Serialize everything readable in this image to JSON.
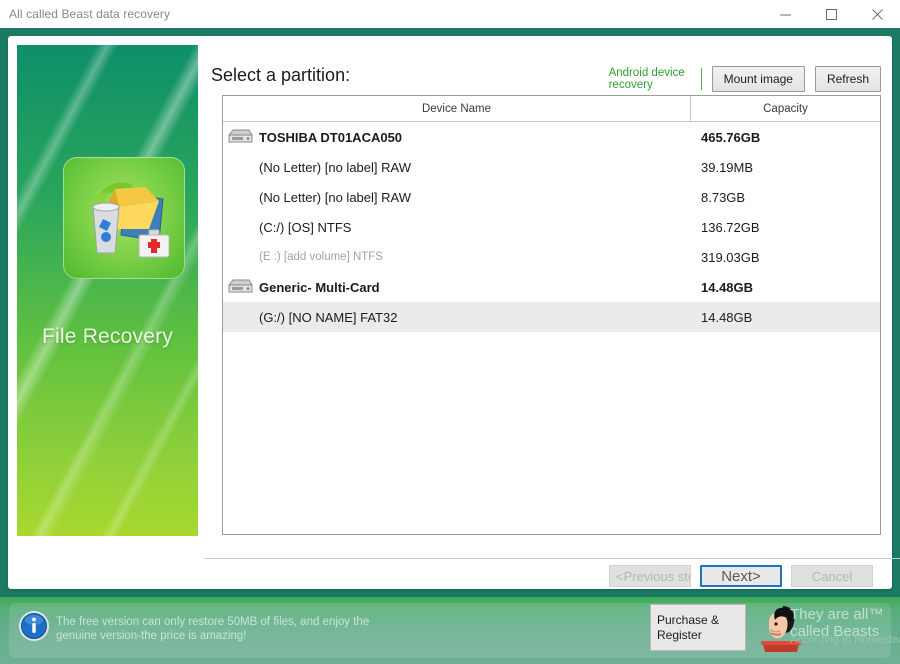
{
  "window": {
    "title": "All called Beast data recovery",
    "controls": [
      {
        "name": "minimize",
        "label": "—"
      },
      {
        "name": "maximize",
        "label": "□"
      },
      {
        "name": "close",
        "label": "✕"
      }
    ]
  },
  "sidebar": {
    "app_title": "File Recovery",
    "icon": "file-recovery-icon"
  },
  "main": {
    "heading": "Select a partition:",
    "toolbar": {
      "android_link": "Android device recovery",
      "mount_image": "Mount image",
      "refresh": "Refresh"
    },
    "table": {
      "columns": [
        "Device Name",
        "Capacity"
      ],
      "rows": [
        {
          "type": "device",
          "name": "TOSHIBA DT01ACA050",
          "capacity": "465.76GB",
          "selected": false,
          "disabled": false,
          "icon": "hard-drive-icon"
        },
        {
          "type": "partition",
          "name": "(No Letter) [no label] RAW",
          "capacity": "39.19MB",
          "selected": false,
          "disabled": false,
          "icon": ""
        },
        {
          "type": "partition",
          "name": "(No Letter) [no label] RAW",
          "capacity": "8.73GB",
          "selected": false,
          "disabled": false,
          "icon": ""
        },
        {
          "type": "partition",
          "name": "(C:/) [OS] NTFS",
          "capacity": "136.72GB",
          "selected": false,
          "disabled": false,
          "icon": ""
        },
        {
          "type": "partition",
          "name": "(E :) [add volume] NTFS",
          "capacity": "319.03GB",
          "selected": false,
          "disabled": true,
          "icon": ""
        },
        {
          "type": "device",
          "name": "Generic- Multi-Card",
          "capacity": "14.48GB",
          "selected": false,
          "disabled": false,
          "icon": "hard-drive-icon"
        },
        {
          "type": "partition",
          "name": "(G:/) [NO NAME] FAT32",
          "capacity": "14.48GB",
          "selected": true,
          "disabled": false,
          "icon": ""
        }
      ]
    },
    "footer": {
      "previous": "<Previous step",
      "next": "Next>",
      "cancel": "Cancel"
    }
  },
  "banner": {
    "info_icon": "info-icon",
    "promo_text": "The free version can only restore 50MB of files, and enjoy the genuine version-the price is amazing!",
    "purchase_button": "Purchase & Register",
    "mascot": "cartoon-mascot-icon",
    "brand_line1": "They are all™",
    "brand_line2": "called Beasts",
    "brand_line3": "According to Homestead"
  },
  "colors": {
    "frame_teal": "#1b7a64",
    "accent_green": "#2fa02f",
    "focus_blue": "#1d74c0",
    "row_selected": "#ebebeb",
    "banner_green": "#64ad8c"
  }
}
